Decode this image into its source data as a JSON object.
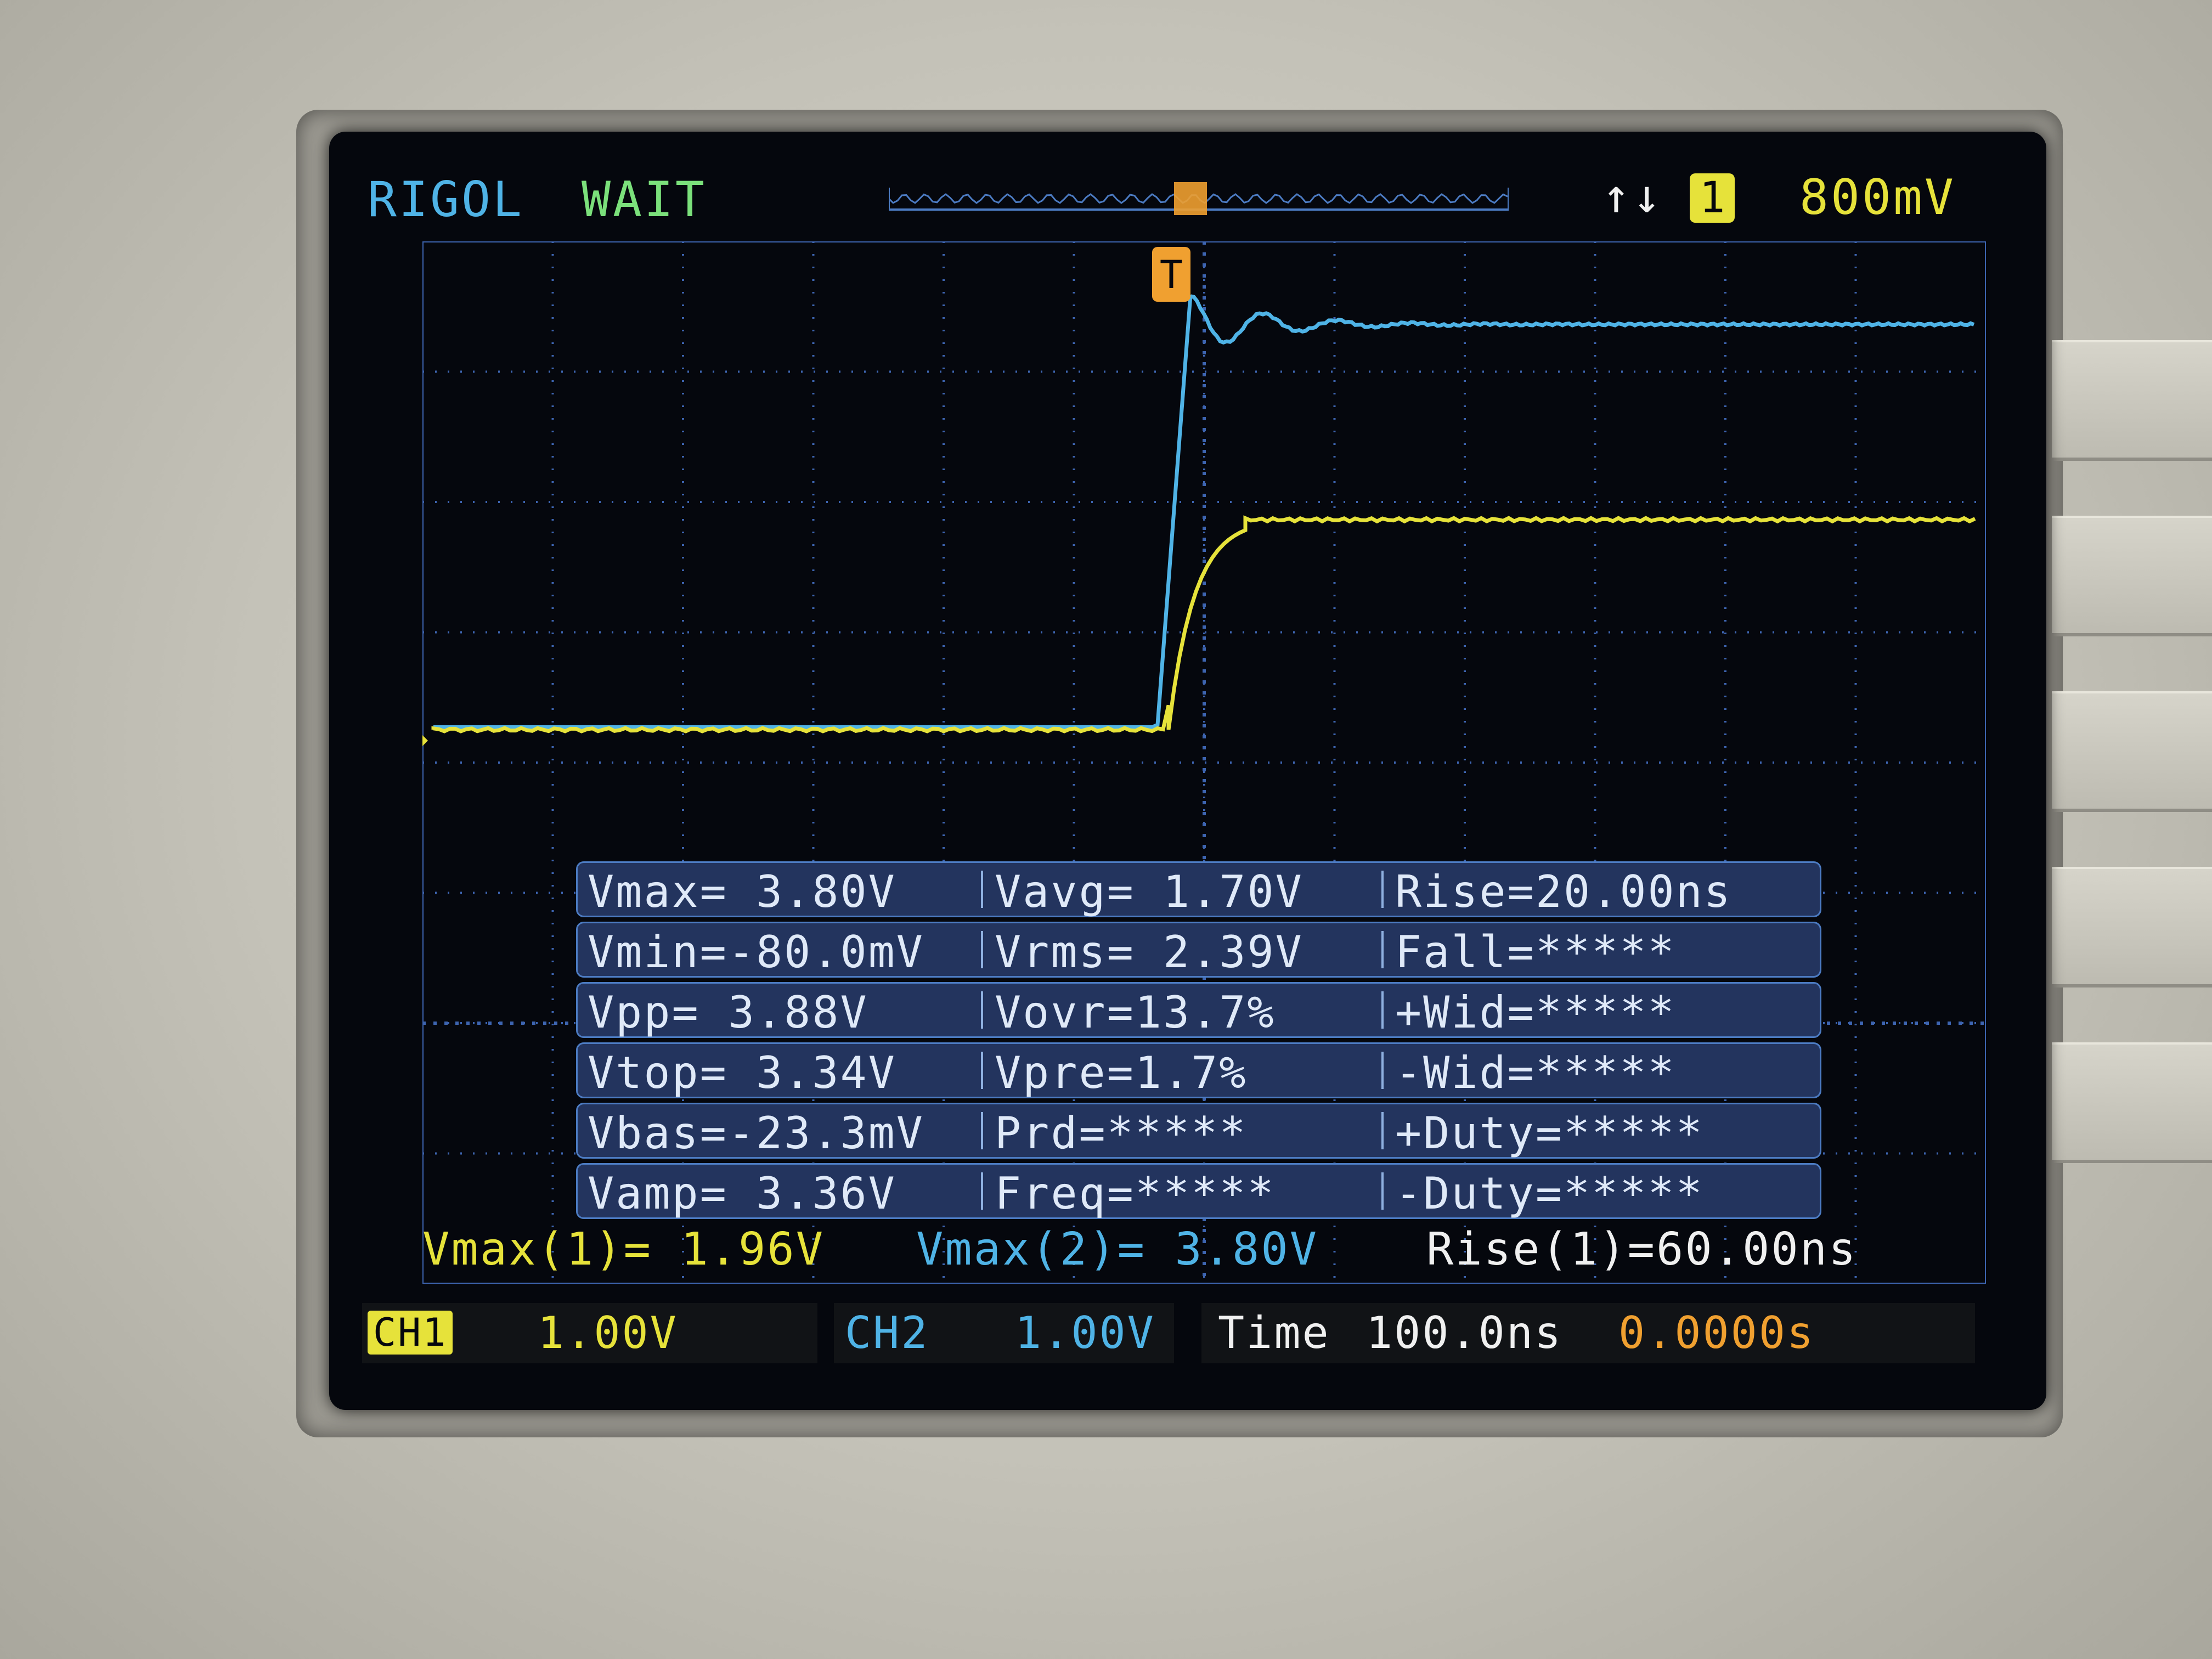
{
  "header": {
    "brand": "RIGOL",
    "status": "WAIT",
    "trigger_edge_icon": "rise-fall-arrows-icon",
    "trigger_source": "1",
    "trigger_level": "800mV"
  },
  "markers": {
    "trigger_marker": "T",
    "ch1_marker": "1"
  },
  "measurements": {
    "rows": [
      {
        "c1": "Vmax= 3.80V",
        "c2": "Vavg= 1.70V",
        "c3": "Rise=20.00ns"
      },
      {
        "c1": "Vmin=-80.0mV",
        "c2": "Vrms= 2.39V",
        "c3": "Fall=*****"
      },
      {
        "c1": "Vpp= 3.88V",
        "c2": "Vovr=13.7%",
        "c3": "+Wid=*****"
      },
      {
        "c1": "Vtop= 3.34V",
        "c2": "Vpre=1.7%",
        "c3": "-Wid=*****"
      },
      {
        "c1": "Vbas=-23.3mV",
        "c2": "Prd=*****",
        "c3": "+Duty=*****"
      },
      {
        "c1": "Vamp= 3.36V",
        "c2": "Freq=*****",
        "c3": "-Duty=*****"
      }
    ]
  },
  "quick_measurements": {
    "q1": "Vmax(1)= 1.96V",
    "q2": "Vmax(2)= 3.80V",
    "q3": "Rise(1)=60.00ns"
  },
  "bottom_bar": {
    "ch1_label": "CH1",
    "ch1_scale": "1.00V",
    "ch2_label": "CH2",
    "ch2_scale": "1.00V",
    "time_label": "Time",
    "time_scale": "100.0ns",
    "trigger_offset": "0.0000s"
  },
  "colors": {
    "ch1": "#e6e23a",
    "ch2": "#4fb3e6",
    "grid": "#3d64b0",
    "screen": "#05070d"
  },
  "waveforms": {
    "ch1_baseline_fraction": 0.0,
    "ch1_final_fraction": 0.43,
    "ch2_final_fraction": 0.83,
    "ch2_overshoot_fraction": 0.89
  }
}
